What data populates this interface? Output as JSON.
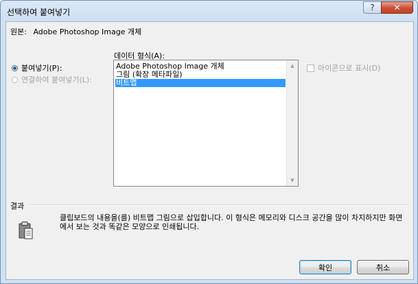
{
  "window": {
    "title": "선택하여 붙여넣기",
    "help_glyph": "?",
    "close_glyph": "✕"
  },
  "source": {
    "label": "원본:",
    "value": "Adobe Photoshop Image 개체"
  },
  "paste_options": {
    "paste": {
      "label": "붙여넣기(P):",
      "checked": true
    },
    "paste_link": {
      "label": "연결하여 붙여넣기(L):",
      "checked": false,
      "disabled": true
    }
  },
  "format": {
    "label": "데이터 형식(A):",
    "items": [
      {
        "label": "Adobe Photoshop Image 개체",
        "selected": false
      },
      {
        "label": "그림 (확장 메타파일)",
        "selected": false
      },
      {
        "label": "비트맵",
        "selected": true
      }
    ]
  },
  "display_as_icon": {
    "label": "아이콘으로 표시(D)",
    "checked": false,
    "disabled": true
  },
  "result": {
    "group_label": "결과",
    "description": "클립보드의 내용을(를) 비트맵 그림으로 삽입합니다. 이 형식은 메모리와 디스크 공간을 많이 차지하지만 화면에서 보는 것과 똑같은 모양으로 인쇄됩니다.",
    "icon": "clipboard-paste-icon"
  },
  "buttons": {
    "ok": "확인",
    "cancel": "취소"
  },
  "colors": {
    "selection": "#3399ff",
    "close_button": "#c74e37",
    "title_gradient": "#dbe8f6"
  }
}
